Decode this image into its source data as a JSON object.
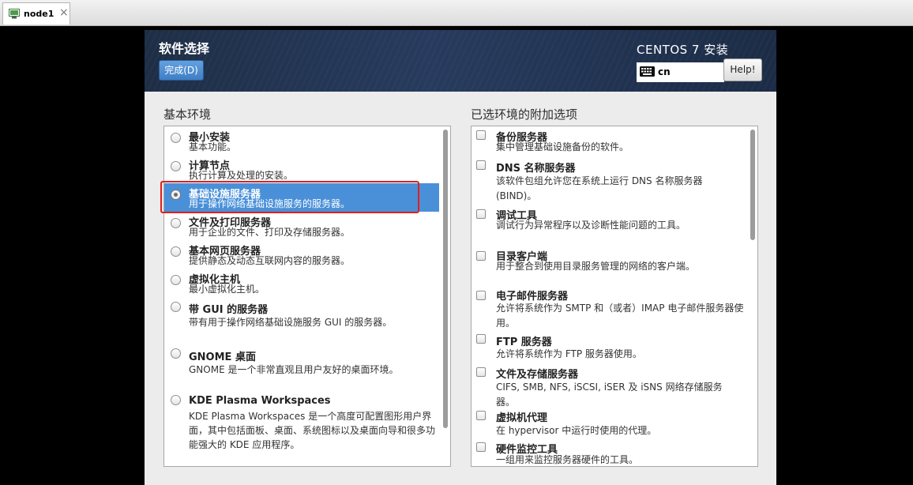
{
  "host_tab": {
    "title": "node1",
    "close_glyph": "×"
  },
  "header": {
    "title": "软件选择",
    "done_label": "完成(D)",
    "product": "CENTOS 7 安装",
    "keyboard_layout": "cn",
    "help_label": "Help!"
  },
  "environments": {
    "label": "基本环境",
    "items": [
      {
        "title": "最小安装",
        "desc": "基本功能。"
      },
      {
        "title": "计算节点",
        "desc": "执行计算及处理的安装。"
      },
      {
        "title": "基础设施服务器",
        "desc": "用于操作网络基础设施服务的服务器。",
        "selected": true
      },
      {
        "title": "文件及打印服务器",
        "desc": "用于企业的文件、打印及存储服务器。"
      },
      {
        "title": "基本网页服务器",
        "desc": "提供静态及动态互联网内容的服务器。"
      },
      {
        "title": "虚拟化主机",
        "desc": "最小虚拟化主机。"
      },
      {
        "title": "带 GUI 的服务器",
        "desc": "带有用于操作网络基础设施服务 GUI 的服务器。"
      },
      {
        "title": "GNOME 桌面",
        "desc": "GNOME 是一个非常直观且用户友好的桌面环境。"
      },
      {
        "title": "KDE Plasma Workspaces",
        "desc": "KDE Plasma Workspaces 是一个高度可配置图形用户界面，其中包括面板、桌面、系统图标以及桌面向导和很多功能强大的 KDE 应用程序。"
      }
    ]
  },
  "addons": {
    "label": "已选环境的附加选项",
    "items": [
      {
        "title": "备份服务器",
        "desc": "集中管理基础设施备份的软件。"
      },
      {
        "title": "DNS 名称服务器",
        "desc": "该软件包组允许您在系统上运行 DNS 名称服务器(BIND)。"
      },
      {
        "title": "调试工具",
        "desc": "调试行为异常程序以及诊断性能问题的工具。"
      },
      {
        "title": "目录客户端",
        "desc": "用于整合到使用目录服务管理的网络的客户端。"
      },
      {
        "title": "电子邮件服务器",
        "desc": "允许将系统作为 SMTP 和（或者）IMAP 电子邮件服务器使用。"
      },
      {
        "title": "FTP 服务器",
        "desc": "允许将系统作为 FTP 服务器使用。"
      },
      {
        "title": "文件及存储服务器",
        "desc": "CIFS, SMB, NFS, iSCSI, iSER 及 iSNS 网络存储服务器。"
      },
      {
        "title": "虚拟机代理",
        "desc": "在 hypervisor 中运行时使用的代理。"
      },
      {
        "title": "硬件监控工具",
        "desc": "一组用来监控服务器硬件的工具。"
      }
    ]
  },
  "colors": {
    "selection": "#4a90d9",
    "annotation_box": "#e0201c",
    "header_bg": "#1e2e46"
  }
}
